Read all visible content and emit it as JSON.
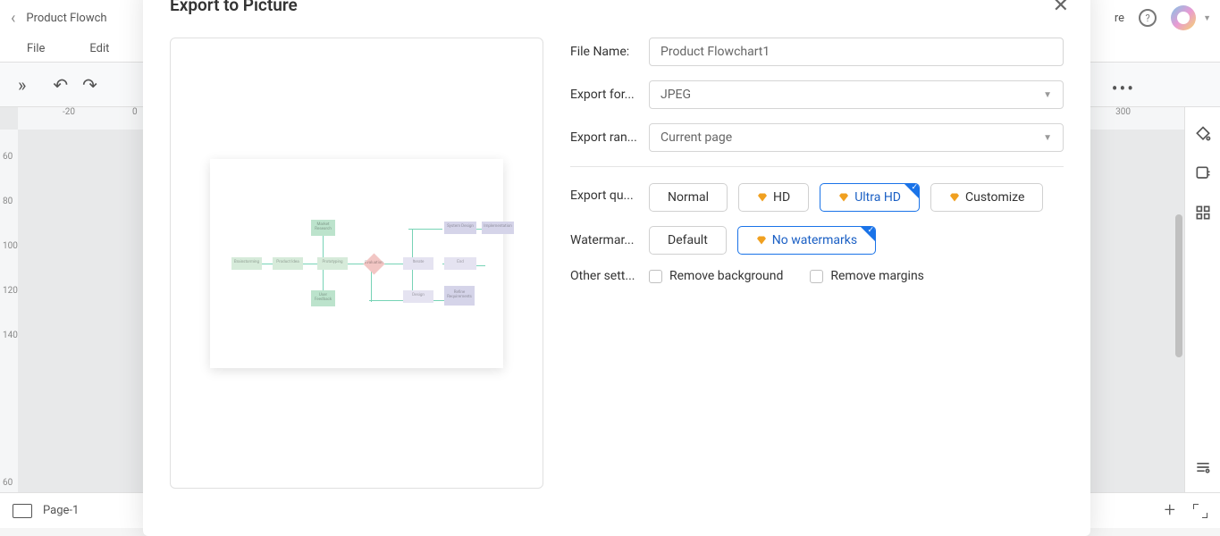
{
  "app": {
    "docTitle": "Product Flowch",
    "menus": {
      "file": "File",
      "edit": "Edit"
    },
    "shareSuffix": "re",
    "pageLabel": "Page-1",
    "rulerH": {
      "m20": "-20",
      "z": "0",
      "p300": "300"
    },
    "rulerV": {
      "v60a": "60",
      "v80": "80",
      "v100": "100",
      "v120": "120",
      "v140": "140",
      "v60b": "60"
    }
  },
  "modal": {
    "title": "Export to Picture",
    "labels": {
      "fileName": "File Name:",
      "format": "Export for...",
      "range": "Export ran...",
      "quality": "Export qu...",
      "watermark": "Watermar...",
      "other": "Other sett..."
    },
    "fileName": "Product Flowchart1",
    "format": "JPEG",
    "range": "Current page",
    "quality": {
      "normal": "Normal",
      "hd": "HD",
      "ultra": "Ultra HD",
      "customize": "Customize"
    },
    "watermark": {
      "default": "Default",
      "none": "No watermarks"
    },
    "other": {
      "removeBg": "Remove background",
      "removeMargins": "Remove margins"
    }
  }
}
